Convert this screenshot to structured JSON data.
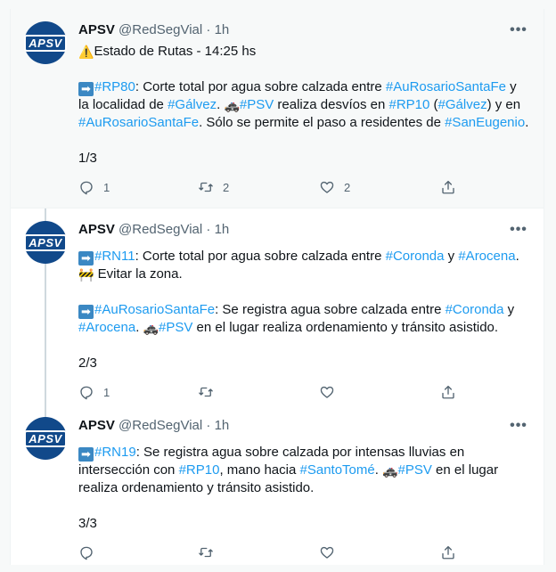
{
  "tweets": [
    {
      "name": "APSV",
      "handle": "@RedSegVial",
      "dot": "·",
      "time": "1h",
      "avatar_text": "APSV",
      "line1_emoji": "⚠️",
      "line1": "Estado de Rutas - 14:25 hs",
      "p1": {
        "t1": "#RP80",
        "t2": ": Corte total por agua sobre calzada entre ",
        "t3": "#AuRosarioSantaFe",
        "t4": " y la localidad de ",
        "t5": "#Gálvez",
        "t6": ". ",
        "t7": "🚓",
        "t8": "#PSV",
        "t9": " realiza desvíos en ",
        "t10": "#RP10",
        "t11": " (",
        "t12": "#Gálvez",
        "t13": ") y en ",
        "t14": "#AuRosarioSantaFe",
        "t15": ". Sólo se permite el paso a residentes de ",
        "t16": "#SanEugenio",
        "t17": "."
      },
      "count": "1/3",
      "replies": "1",
      "retweets": "2",
      "likes": "2"
    },
    {
      "name": "APSV",
      "handle": "@RedSegVial",
      "dot": "·",
      "time": "1h",
      "avatar_text": "APSV",
      "p1": {
        "t1": "#RN11",
        "t2": ": Corte total por agua sobre calzada entre ",
        "t3": "#Coronda",
        "t4": " y ",
        "t5": "#Arocena",
        "t6": ".",
        "t7": "🚧",
        "t8": " Evitar la zona."
      },
      "p2": {
        "t1": "#AuRosarioSantaFe",
        "t2": ": Se registra agua sobre calzada entre ",
        "t3": "#Coronda",
        "t4": " y ",
        "t5": "#Arocena",
        "t6": ". ",
        "t7": "🚓",
        "t8": "#PSV",
        "t9": " en el lugar realiza ordenamiento y tránsito asistido."
      },
      "count": "2/3",
      "replies": "1",
      "retweets": "",
      "likes": ""
    },
    {
      "name": "APSV",
      "handle": "@RedSegVial",
      "dot": "·",
      "time": "1h",
      "avatar_text": "APSV",
      "p1": {
        "t1": "#RN19",
        "t2": ": Se registra agua sobre calzada por intensas lluvias en intersección con ",
        "t3": "#RP10",
        "t4": ", mano hacia ",
        "t5": "#SantoTomé",
        "t6": ". ",
        "t7": "🚓",
        "t8": "#PSV",
        "t9": " en el lugar realiza ordenamiento y tránsito asistido."
      },
      "count": "3/3",
      "replies": "",
      "retweets": "",
      "likes": ""
    }
  ],
  "ui": {
    "more_glyph": "•••",
    "arrow_glyph": "➡",
    "icons": [
      "reply-icon",
      "retweet-icon",
      "like-icon",
      "share-icon",
      "more-icon"
    ],
    "colors": {
      "link": "#1d9bf0",
      "muted": "#536471",
      "avatar_bg": "#11498a",
      "thread_line": "#cfd9de"
    }
  }
}
